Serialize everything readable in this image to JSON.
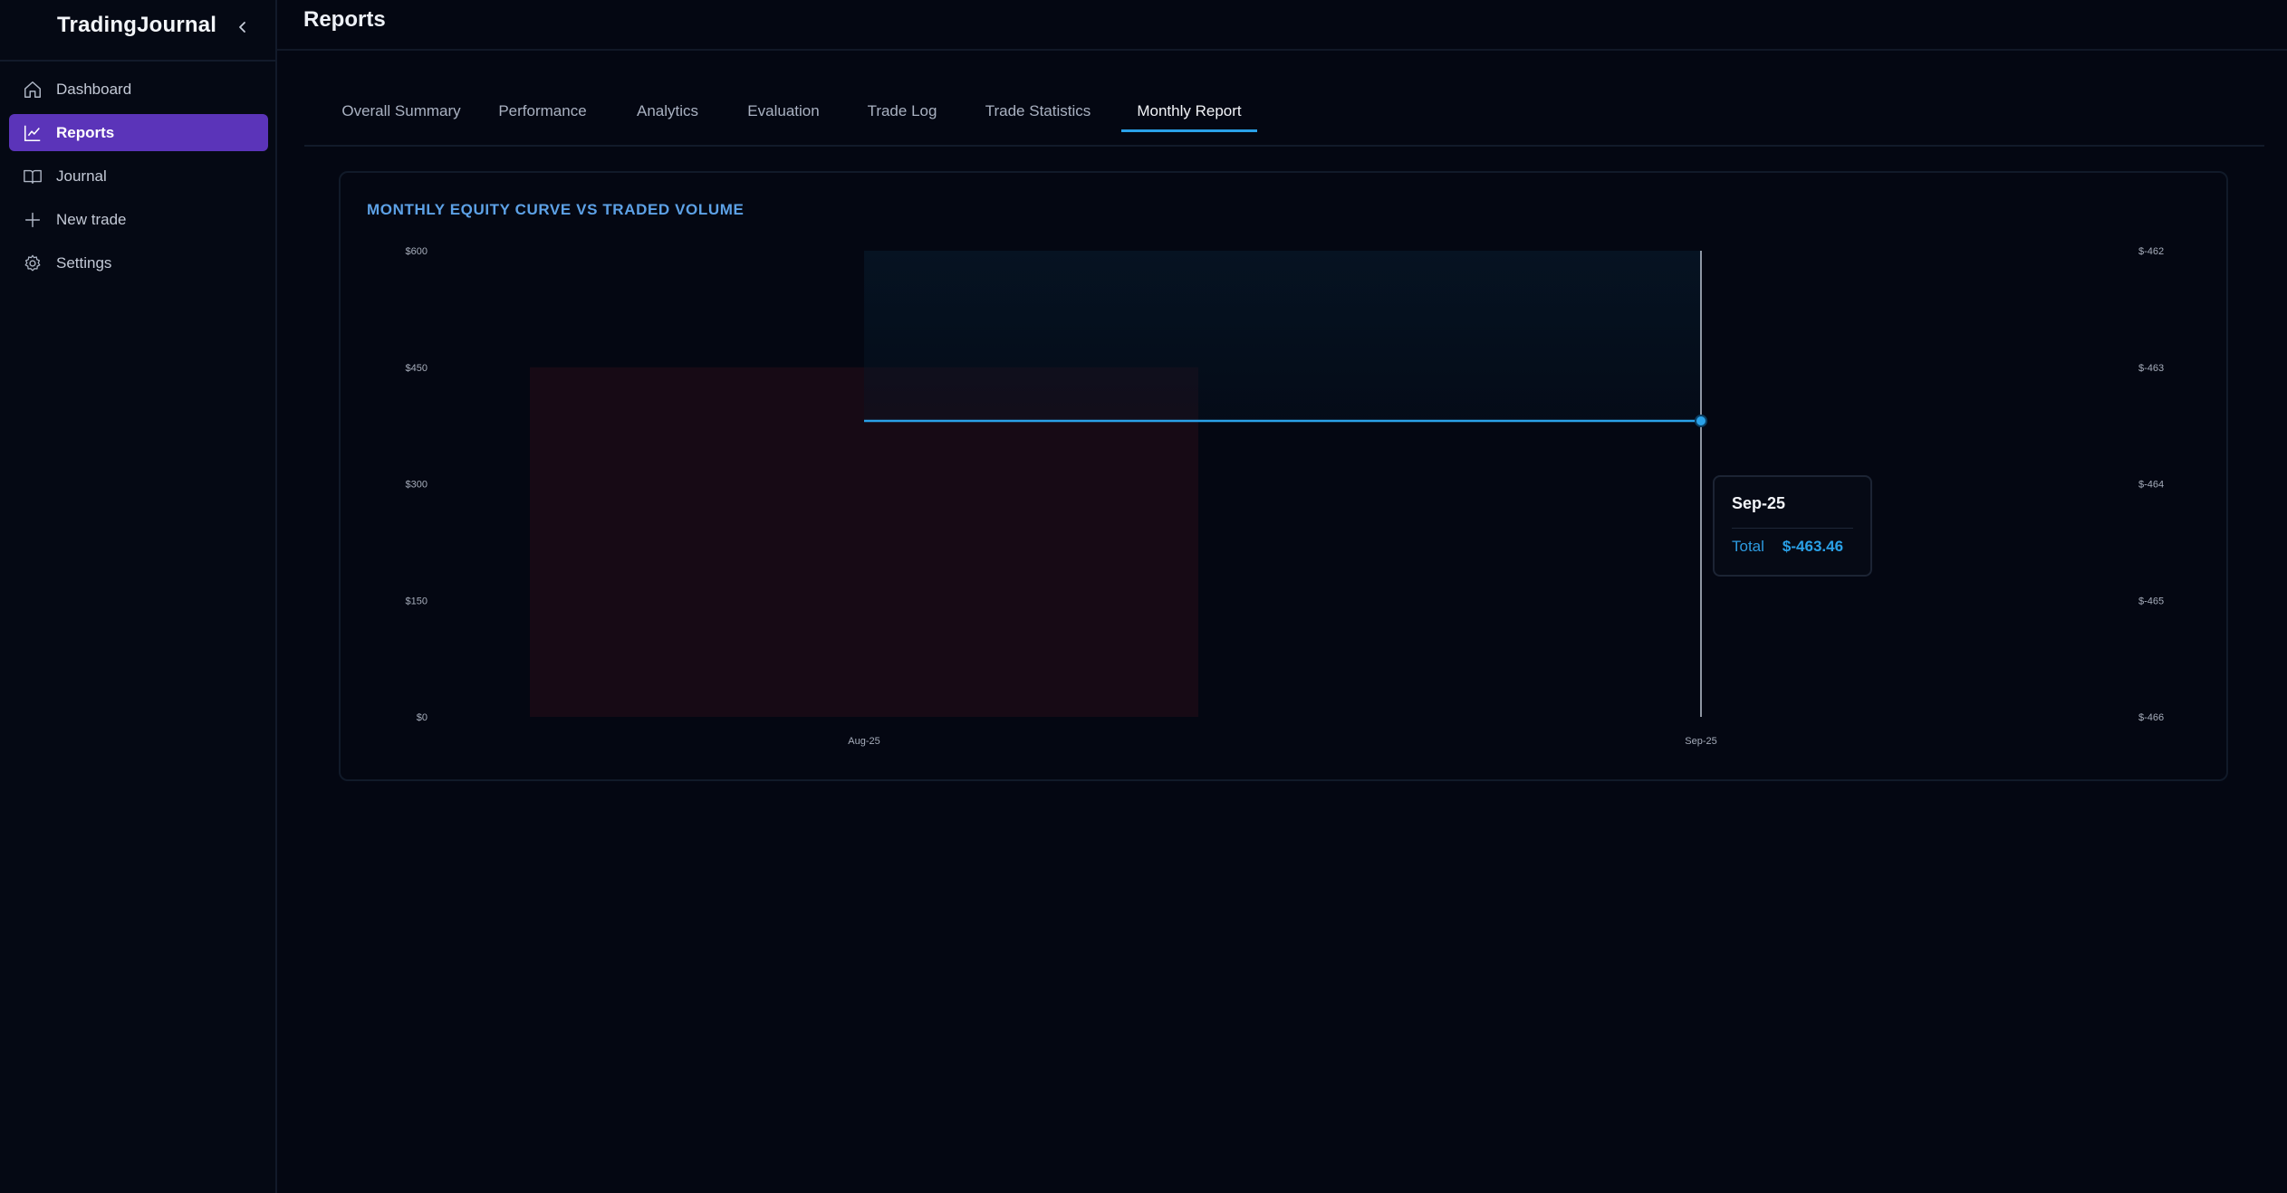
{
  "app": {
    "title": "TradingJournal"
  },
  "sidebar": {
    "items": [
      {
        "label": "Dashboard",
        "icon": "home-icon",
        "active": false
      },
      {
        "label": "Reports",
        "icon": "chart-line-icon",
        "active": true
      },
      {
        "label": "Journal",
        "icon": "book-icon",
        "active": false
      },
      {
        "label": "New trade",
        "icon": "plus-icon",
        "active": false
      },
      {
        "label": "Settings",
        "icon": "gear-icon",
        "active": false
      }
    ]
  },
  "header": {
    "title": "Reports"
  },
  "tabs": [
    {
      "label": "Overall Summary",
      "active": false
    },
    {
      "label": "Performance",
      "active": false
    },
    {
      "label": "Analytics",
      "active": false
    },
    {
      "label": "Evaluation",
      "active": false
    },
    {
      "label": "Trade Log",
      "active": false
    },
    {
      "label": "Trade Statistics",
      "active": false
    },
    {
      "label": "Monthly Report",
      "active": true
    }
  ],
  "card": {
    "title": "MONTHLY EQUITY CURVE VS TRADED VOLUME"
  },
  "chart_data": {
    "type": "bar",
    "title": "MONTHLY EQUITY CURVE VS TRADED VOLUME",
    "categories": [
      "Aug-25",
      "Sep-25"
    ],
    "series": [
      {
        "axis": "left",
        "kind": "bar",
        "values": [
          450,
          null
        ],
        "color": "#1a0b16"
      },
      {
        "name": "Total",
        "axis": "right",
        "kind": "area-line",
        "values": [
          -463.46,
          -463.46
        ],
        "color": "#2aa1e8"
      }
    ],
    "left_axis": {
      "ylim": [
        0,
        600
      ],
      "ticks": [
        "$600",
        "$450",
        "$300",
        "$150",
        "$0"
      ]
    },
    "right_axis": {
      "ylim": [
        -466,
        -462
      ],
      "ticks": [
        "$-462",
        "$-463",
        "$-464",
        "$-465",
        "$-466"
      ]
    },
    "x_ticks": [
      "Aug-25",
      "Sep-25"
    ],
    "tooltip": {
      "category": "Sep-25",
      "label": "Total",
      "value": "$-463.46"
    },
    "colors": {
      "accent": "#2aa1e8",
      "bar": "#1a0b16",
      "area": "#061626"
    }
  }
}
